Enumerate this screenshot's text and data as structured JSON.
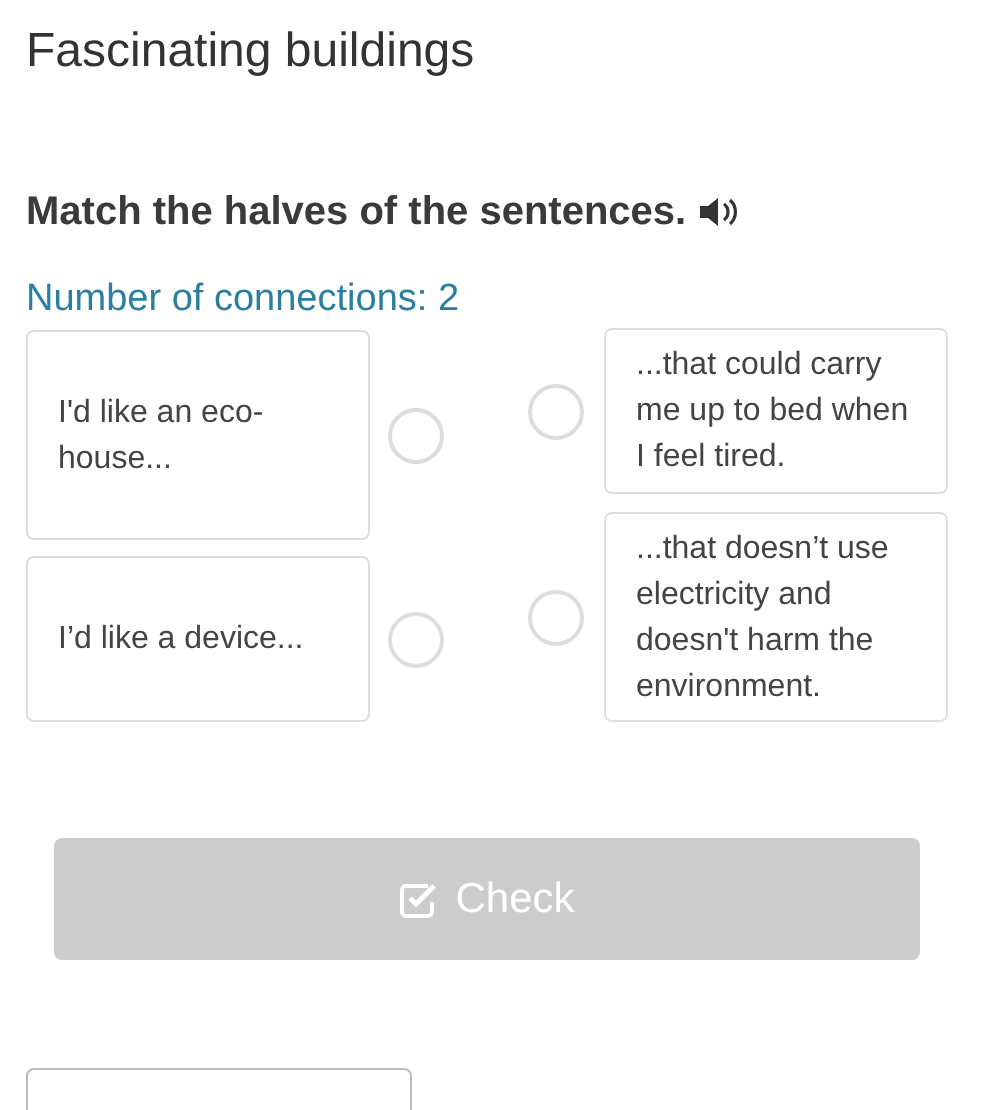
{
  "title": "Fascinating buildings",
  "instruction": "Match the halves of the sentences.",
  "connections_label": "Number of connections: 2",
  "left_items": [
    {
      "text": "I'd like an eco-house..."
    },
    {
      "text": "I’d like a device..."
    }
  ],
  "right_items": [
    {
      "text": "...that could carry me up to bed when I feel tired."
    },
    {
      "text": "...that doesn’t use electricity and doesn't harm the environment."
    }
  ],
  "check_button": {
    "label": "Check",
    "disabled": true
  }
}
